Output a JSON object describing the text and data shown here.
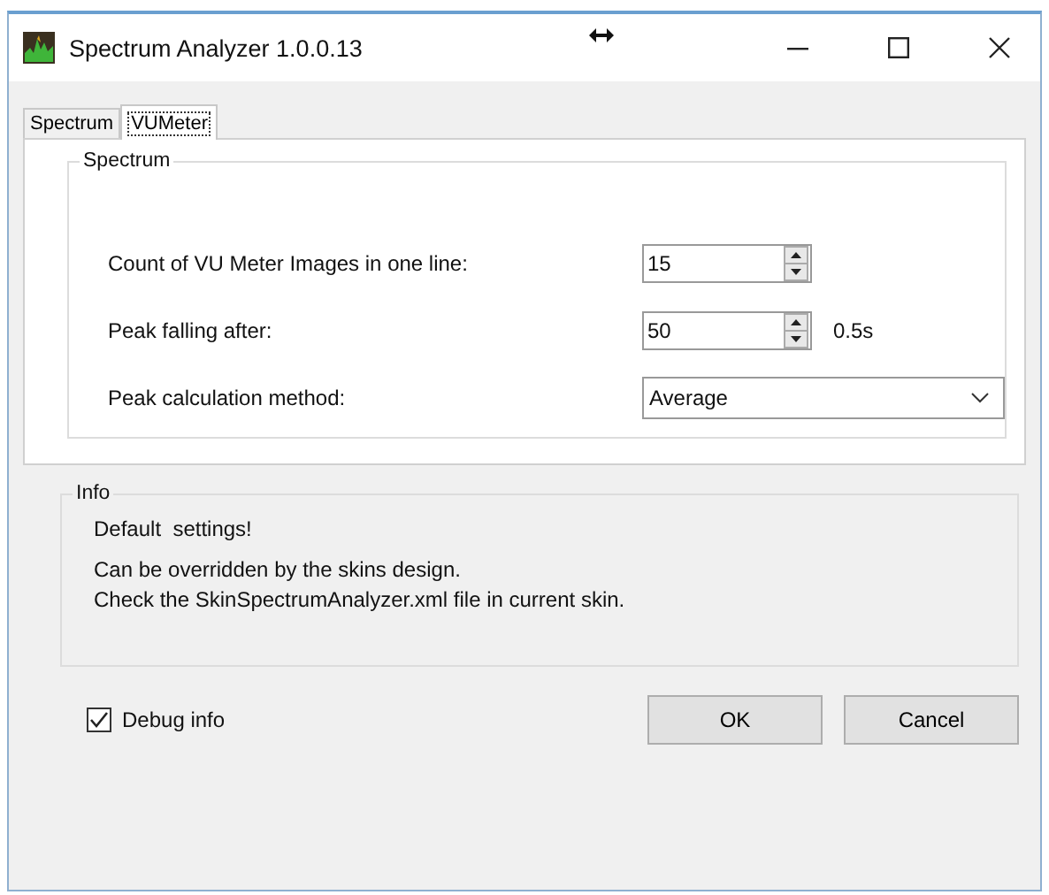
{
  "window": {
    "title": "Spectrum Analyzer 1.0.0.13"
  },
  "tabs": [
    {
      "label": "Spectrum",
      "selected": false
    },
    {
      "label": "VUMeter",
      "selected": true
    }
  ],
  "settings_group": {
    "title": "Spectrum",
    "fields": [
      {
        "kind": "spin",
        "label": "Count of VU Meter Images in one line:",
        "value": "15"
      },
      {
        "kind": "spin",
        "label": "Peak falling after:",
        "value": "50",
        "suffix": "0.5s"
      },
      {
        "kind": "select",
        "label": "Peak calculation method:",
        "value": "Average"
      }
    ]
  },
  "info_group": {
    "title": "Info",
    "lines": [
      {
        "text": "Default  settings!"
      },
      {
        "text": "Can be overridden by the skins design."
      },
      {
        "text": "Check the SkinSpectrumAnalyzer.xml file in current skin."
      }
    ]
  },
  "debug": {
    "label": "Debug info",
    "checked": true
  },
  "buttons": [
    "OK",
    "Cancel"
  ]
}
